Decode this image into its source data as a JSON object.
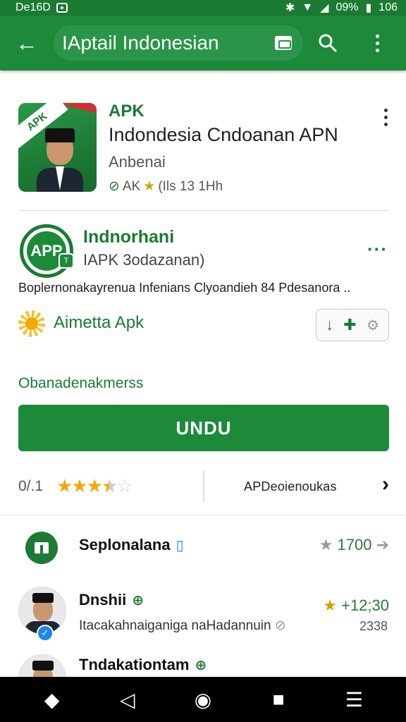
{
  "status_bar": {
    "left_text": "De16D",
    "battery": "09%",
    "time": "106"
  },
  "app_bar": {
    "title": "IAptail Indonesian"
  },
  "app": {
    "icon_text": "APK",
    "developer": "APK",
    "name": "Indondesia Cndoanan APN",
    "subtitle": "Anbenai",
    "rating_prefix": "AK",
    "rating_text": "(Ils 13 1Hh"
  },
  "dev_card": {
    "logo_text": "APP",
    "name": "Indnorhani",
    "handle": "IAPK 3odazanan)",
    "description": "Boplernonakayrenua Infenians Clyoandieh 84 Pdesanora .."
  },
  "feature": {
    "label": "Aimetta Apk"
  },
  "section_label": "Obanadenakmerss",
  "install_button": {
    "label": "UNDU"
  },
  "rating": {
    "value_label": "0/.1",
    "stars_value": 3.5,
    "stars_max": 5,
    "link_label": "APDeoienoukas"
  },
  "list": [
    {
      "title": "Seplonalana",
      "right_text": "1700"
    },
    {
      "title": "Dnshii",
      "subtitle": "Itacakahnaiganiga naHadannuin",
      "right_text": "+12;30",
      "right_sub": "2338"
    },
    {
      "title": "Tndakationtam"
    }
  ],
  "colors": {
    "primary": "#1d8a3a",
    "primary_dark": "#1b7a33",
    "star": "#f2a900"
  }
}
